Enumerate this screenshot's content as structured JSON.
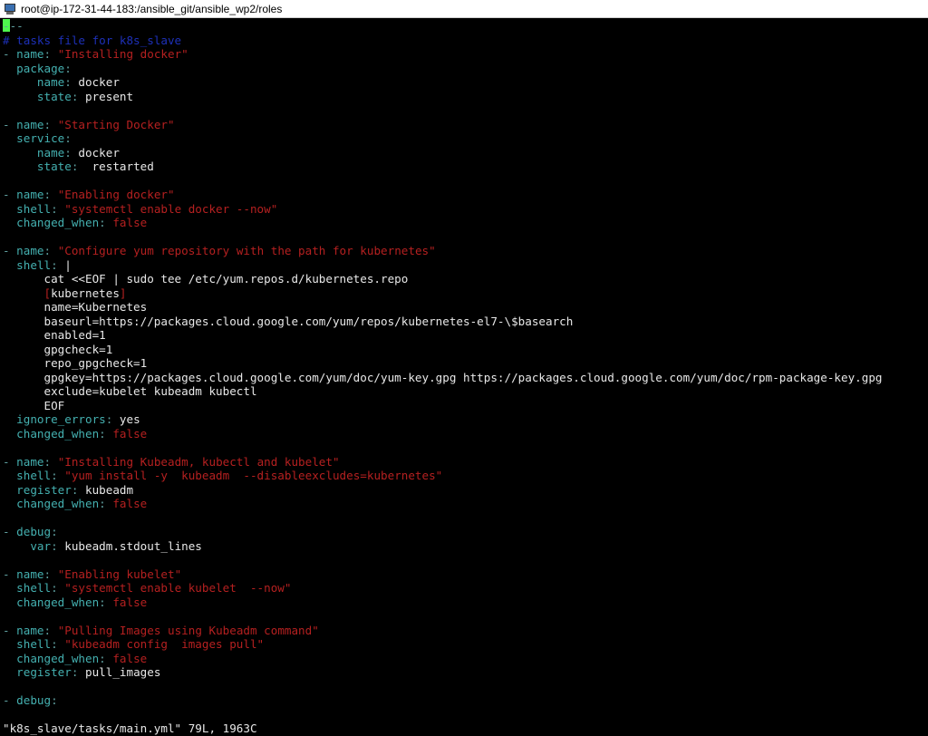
{
  "window": {
    "title": "root@ip-172-31-44-183:/ansible_git/ansible_wp2/roles"
  },
  "editor": {
    "lines": [
      [
        {
          "t": "---",
          "c": "punct"
        }
      ],
      [
        {
          "t": "# tasks file for k8s_slave",
          "c": "comment"
        }
      ],
      [
        {
          "t": "- ",
          "c": "punct"
        },
        {
          "t": "name",
          "c": "key"
        },
        {
          "t": ": ",
          "c": "punct"
        },
        {
          "t": "\"Installing docker\"",
          "c": "string"
        }
      ],
      [
        {
          "t": "  package",
          "c": "key"
        },
        {
          "t": ":",
          "c": "punct"
        }
      ],
      [
        {
          "t": "     name",
          "c": "key"
        },
        {
          "t": ": ",
          "c": "punct"
        },
        {
          "t": "docker",
          "c": "value"
        }
      ],
      [
        {
          "t": "     state",
          "c": "key"
        },
        {
          "t": ": ",
          "c": "punct"
        },
        {
          "t": "present",
          "c": "value"
        }
      ],
      [],
      [
        {
          "t": "- ",
          "c": "punct"
        },
        {
          "t": "name",
          "c": "key"
        },
        {
          "t": ": ",
          "c": "punct"
        },
        {
          "t": "\"Starting Docker\"",
          "c": "string"
        }
      ],
      [
        {
          "t": "  service",
          "c": "key"
        },
        {
          "t": ":",
          "c": "punct"
        }
      ],
      [
        {
          "t": "     name",
          "c": "key"
        },
        {
          "t": ": ",
          "c": "punct"
        },
        {
          "t": "docker",
          "c": "value"
        }
      ],
      [
        {
          "t": "     state",
          "c": "key"
        },
        {
          "t": ":  ",
          "c": "punct"
        },
        {
          "t": "restarted",
          "c": "value"
        }
      ],
      [],
      [
        {
          "t": "- ",
          "c": "punct"
        },
        {
          "t": "name",
          "c": "key"
        },
        {
          "t": ": ",
          "c": "punct"
        },
        {
          "t": "\"Enabling docker\"",
          "c": "string"
        }
      ],
      [
        {
          "t": "  shell",
          "c": "key"
        },
        {
          "t": ": ",
          "c": "punct"
        },
        {
          "t": "\"systemctl enable docker --now\"",
          "c": "string"
        }
      ],
      [
        {
          "t": "  changed_when",
          "c": "key"
        },
        {
          "t": ": ",
          "c": "punct"
        },
        {
          "t": "false",
          "c": "string"
        }
      ],
      [],
      [
        {
          "t": "- ",
          "c": "punct"
        },
        {
          "t": "name",
          "c": "key"
        },
        {
          "t": ": ",
          "c": "punct"
        },
        {
          "t": "\"Configure yum repository with the path for kubernetes\"",
          "c": "string"
        }
      ],
      [
        {
          "t": "  shell",
          "c": "key"
        },
        {
          "t": ": ",
          "c": "punct"
        },
        {
          "t": "|",
          "c": "value"
        }
      ],
      [
        {
          "t": "      cat <<EOF | sudo tee /etc/yum.repos.d/kubernetes.repo",
          "c": "value"
        }
      ],
      [
        {
          "t": "      ",
          "c": "value"
        },
        {
          "t": "[",
          "c": "string"
        },
        {
          "t": "kubernetes",
          "c": "value"
        },
        {
          "t": "]",
          "c": "string"
        }
      ],
      [
        {
          "t": "      name=Kubernetes",
          "c": "value"
        }
      ],
      [
        {
          "t": "      baseurl=https://packages.cloud.google.com/yum/repos/kubernetes-el7-\\$basearch",
          "c": "value"
        }
      ],
      [
        {
          "t": "      enabled=1",
          "c": "value"
        }
      ],
      [
        {
          "t": "      gpgcheck=1",
          "c": "value"
        }
      ],
      [
        {
          "t": "      repo_gpgcheck=1",
          "c": "value"
        }
      ],
      [
        {
          "t": "      gpgkey=https://packages.cloud.google.com/yum/doc/yum-key.gpg https://packages.cloud.google.com/yum/doc/rpm-package-key.gpg",
          "c": "value"
        }
      ],
      [
        {
          "t": "      exclude=kubelet kubeadm kubectl",
          "c": "value"
        }
      ],
      [
        {
          "t": "      EOF",
          "c": "value"
        }
      ],
      [
        {
          "t": "  ignore_errors",
          "c": "key"
        },
        {
          "t": ": ",
          "c": "punct"
        },
        {
          "t": "yes",
          "c": "value"
        }
      ],
      [
        {
          "t": "  changed_when",
          "c": "key"
        },
        {
          "t": ": ",
          "c": "punct"
        },
        {
          "t": "false",
          "c": "string"
        }
      ],
      [],
      [
        {
          "t": "- ",
          "c": "punct"
        },
        {
          "t": "name",
          "c": "key"
        },
        {
          "t": ": ",
          "c": "punct"
        },
        {
          "t": "\"Installing Kubeadm, kubectl and kubelet\"",
          "c": "string"
        }
      ],
      [
        {
          "t": "  shell",
          "c": "key"
        },
        {
          "t": ": ",
          "c": "punct"
        },
        {
          "t": "\"yum install -y  kubeadm  --disableexcludes=kubernetes\"",
          "c": "string"
        }
      ],
      [
        {
          "t": "  register",
          "c": "key"
        },
        {
          "t": ": ",
          "c": "punct"
        },
        {
          "t": "kubeadm",
          "c": "value"
        }
      ],
      [
        {
          "t": "  changed_when",
          "c": "key"
        },
        {
          "t": ": ",
          "c": "punct"
        },
        {
          "t": "false",
          "c": "string"
        }
      ],
      [],
      [
        {
          "t": "- ",
          "c": "punct"
        },
        {
          "t": "debug",
          "c": "key"
        },
        {
          "t": ":",
          "c": "punct"
        }
      ],
      [
        {
          "t": "    var",
          "c": "key"
        },
        {
          "t": ": ",
          "c": "punct"
        },
        {
          "t": "kubeadm.stdout_lines",
          "c": "value"
        }
      ],
      [],
      [
        {
          "t": "- ",
          "c": "punct"
        },
        {
          "t": "name",
          "c": "key"
        },
        {
          "t": ": ",
          "c": "punct"
        },
        {
          "t": "\"Enabling kubelet\"",
          "c": "string"
        }
      ],
      [
        {
          "t": "  shell",
          "c": "key"
        },
        {
          "t": ": ",
          "c": "punct"
        },
        {
          "t": "\"systemctl enable kubelet  --now\"",
          "c": "string"
        }
      ],
      [
        {
          "t": "  changed_when",
          "c": "key"
        },
        {
          "t": ": ",
          "c": "punct"
        },
        {
          "t": "false",
          "c": "string"
        }
      ],
      [],
      [
        {
          "t": "- ",
          "c": "punct"
        },
        {
          "t": "name",
          "c": "key"
        },
        {
          "t": ": ",
          "c": "punct"
        },
        {
          "t": "\"Pulling Images using Kubeadm command\"",
          "c": "string"
        }
      ],
      [
        {
          "t": "  shell",
          "c": "key"
        },
        {
          "t": ": ",
          "c": "punct"
        },
        {
          "t": "\"kubeadm config  images pull\"",
          "c": "string"
        }
      ],
      [
        {
          "t": "  changed_when",
          "c": "key"
        },
        {
          "t": ": ",
          "c": "punct"
        },
        {
          "t": "false",
          "c": "string"
        }
      ],
      [
        {
          "t": "  register",
          "c": "key"
        },
        {
          "t": ": ",
          "c": "punct"
        },
        {
          "t": "pull_images",
          "c": "value"
        }
      ],
      [],
      [
        {
          "t": "- ",
          "c": "punct"
        },
        {
          "t": "debug",
          "c": "key"
        },
        {
          "t": ":",
          "c": "punct"
        }
      ]
    ],
    "status_line": "\"k8s_slave/tasks/main.yml\" 79L, 1963C"
  },
  "colors": {
    "background": "#000000",
    "key": "#44b0b0",
    "string": "#b52020",
    "comment": "#1d30b8",
    "value": "#e8e8e8",
    "cursor": "#4ef84e"
  }
}
